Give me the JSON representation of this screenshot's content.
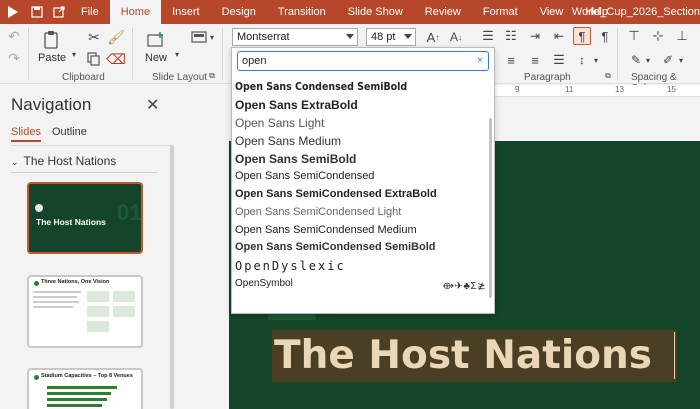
{
  "menubar": {
    "tabs": [
      "File",
      "Home",
      "Insert",
      "Design",
      "Transition",
      "Slide Show",
      "Review",
      "Format",
      "View",
      "Help"
    ],
    "active": "Home",
    "document": "World_Cup_2026_Section",
    "bg": "#b7472a"
  },
  "ribbon": {
    "paste": "Paste",
    "clipboard": "Clipboard",
    "new": "New",
    "slide_layout": "Slide Layout",
    "font_name": "Montserrat",
    "font_size": "48 pt",
    "paragraph": "Paragraph",
    "spacing_color": "Spacing & Color"
  },
  "font_dropdown": {
    "query": "open",
    "clear": "×",
    "items": [
      "Open Sans Condensed SemiBold",
      "Open Sans ExtraBold",
      "Open Sans Light",
      "Open Sans Medium",
      "Open Sans SemiBold",
      "Open Sans SemiCondensed",
      "Open Sans SemiCondensed ExtraBold",
      "Open Sans SemiCondensed Light",
      "Open Sans SemiCondensed Medium",
      "Open Sans SemiCondensed SemiBold",
      "OpenDyslexic",
      "OpenSymbol"
    ],
    "opensymbol_sample": "⟴✈♣Σ≵"
  },
  "navigation": {
    "title": "Navigation",
    "close": "✕",
    "tabs": [
      "Slides",
      "Outline"
    ],
    "section": "The Host Nations",
    "slides": [
      {
        "title": "The Host Nations"
      },
      {
        "title": "Three Nations, One Vision"
      },
      {
        "title": "Stadium Capacities – Top 8 Venues"
      }
    ]
  },
  "ruler": [
    "9",
    "11",
    "13",
    "15"
  ],
  "slide": {
    "title": "The Host Nations",
    "bg": "#14452a"
  }
}
